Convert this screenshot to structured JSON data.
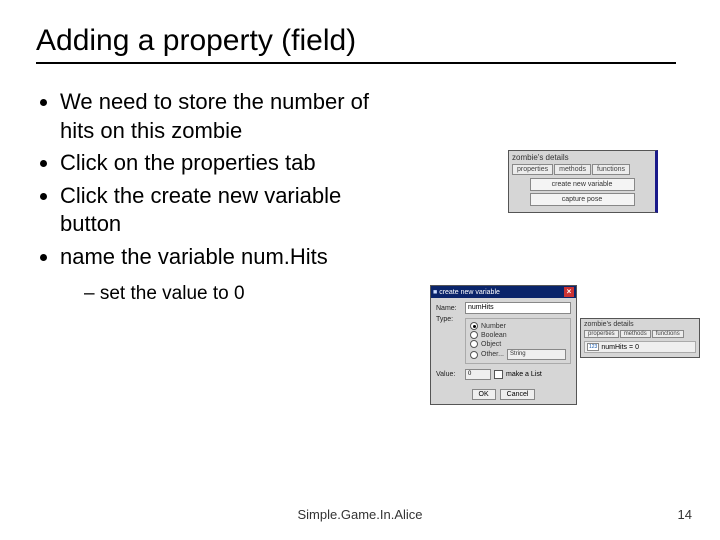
{
  "title": "Adding a property (field)",
  "bullets": [
    "We need to store the number of hits on this zombie",
    "Click on the properties tab",
    "Click the create new variable button",
    "name the variable num.Hits"
  ],
  "sub_bullet": "set the value to 0",
  "footer": "Simple.Game.In.Alice",
  "page": "14",
  "panel1": {
    "header": "zombie's details",
    "tabs": [
      "properties",
      "methods",
      "functions"
    ],
    "btn_create": "create new variable",
    "btn_capture": "capture pose"
  },
  "panel2": {
    "title": "create new variable",
    "name_label": "Name:",
    "name_value": "numHits",
    "type_label": "Type:",
    "types": [
      "Number",
      "Boolean",
      "Object",
      "Other..."
    ],
    "other_value": "String",
    "value_label": "Value:",
    "value_value": "0",
    "list_label": "make a List",
    "ok": "OK",
    "cancel": "Cancel"
  },
  "panel3": {
    "header": "zombie's details",
    "tabs": [
      "properties",
      "methods",
      "functions"
    ],
    "prop_icon": "123",
    "prop_name": "numHits",
    "prop_eq": "=",
    "prop_val": "0"
  }
}
